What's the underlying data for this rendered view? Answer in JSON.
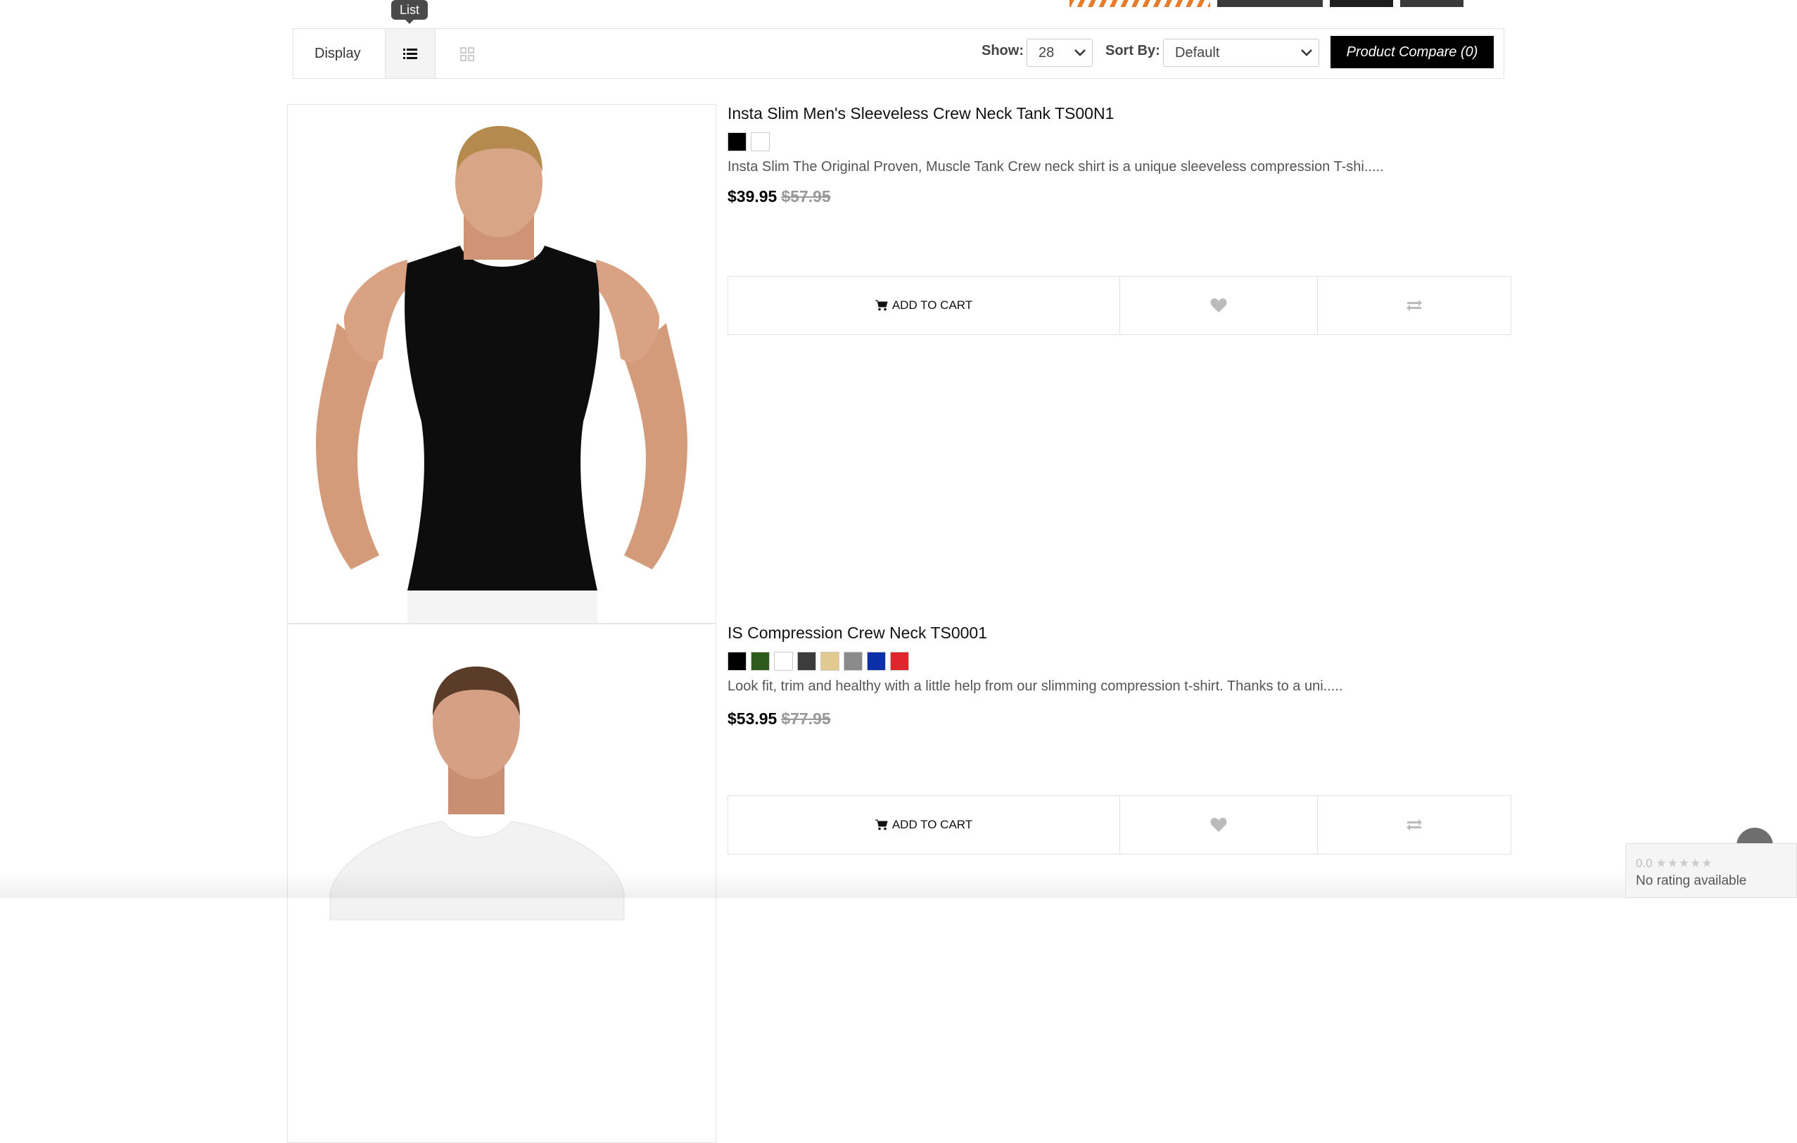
{
  "tooltip": {
    "text": "List"
  },
  "toolbar": {
    "display_label": "Display",
    "show_label": "Show:",
    "show_value": "28",
    "sort_label": "Sort By:",
    "sort_value": "Default",
    "compare_label": "Product Compare (0)"
  },
  "products": [
    {
      "title": "Insta Slim Men's Sleeveless Crew Neck Tank TS00N1",
      "swatches": [
        "#000000",
        "#ffffff"
      ],
      "description": "Insta Slim The Original Proven, Muscle Tank Crew neck shirt is a unique sleeveless compression T-shi.....",
      "price": "$39.95",
      "old_price": "$57.95",
      "add_to_cart": "ADD TO CART"
    },
    {
      "title": "IS Compression Crew Neck TS0001",
      "swatches": [
        "#000000",
        "#2f5a1e",
        "#ffffff",
        "#3c3c3c",
        "#e2c98f",
        "#8a8a8a",
        "#0a2fa8",
        "#e0262d"
      ],
      "description": "Look fit, trim and healthy with a little help from our slimming compression t-shirt. Thanks to a uni.....",
      "price": "$53.95",
      "old_price": "$77.95",
      "add_to_cart": "ADD TO CART"
    }
  ],
  "rating_widget": {
    "score": "0.0",
    "text": "No rating available"
  },
  "icons": {
    "list_view": "list-icon",
    "grid_view": "grid-icon",
    "cart": "cart-icon",
    "wishlist": "heart-icon",
    "compare": "compare-icon",
    "dropdown": "chevron-down-icon"
  }
}
